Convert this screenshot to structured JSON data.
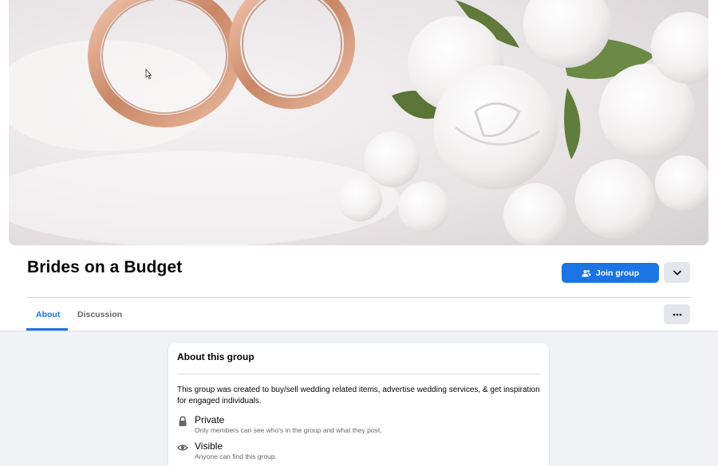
{
  "group": {
    "name": "Brides on a Budget",
    "join_label": "Join group"
  },
  "tabs": [
    {
      "label": "About",
      "active": true
    },
    {
      "label": "Discussion",
      "active": false
    }
  ],
  "about": {
    "title": "About this group",
    "description": "This group was created to buy/sell wedding related items, advertise wedding services, & get inspiration for engaged individuals.",
    "privacy": {
      "icon": "lock-icon",
      "title": "Private",
      "subtitle": "Only members can see who's in the group and what they post."
    },
    "visibility": {
      "icon": "eye-icon",
      "title": "Visible",
      "subtitle": "Anyone can find this group."
    }
  },
  "colors": {
    "accent": "#1b74e4",
    "button_gray": "#e4e6eb",
    "page_bg": "#f0f2f5"
  }
}
